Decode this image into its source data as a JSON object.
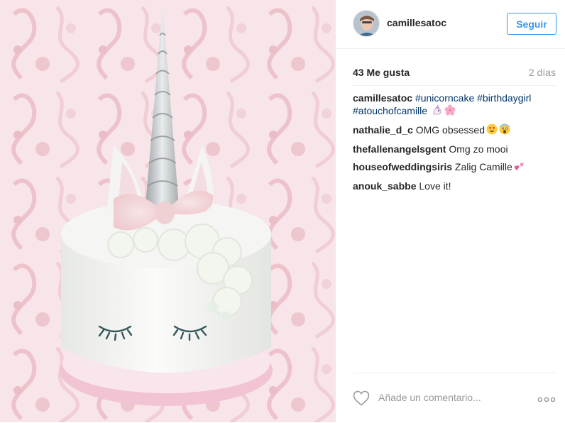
{
  "post": {
    "username": "camillesatoc",
    "follow_label": "Seguir",
    "likes": "43 Me gusta",
    "time": "2 días",
    "caption": {
      "user": "camillesatoc",
      "hashtags": [
        "#unicorncake",
        "#birthdaygirl",
        "#atouchofcamille"
      ],
      "emojis": [
        "unicorn-emoji",
        "cherry-blossom-emoji"
      ]
    },
    "comments": [
      {
        "user": "nathalie_d_c",
        "text": "OMG obsessed",
        "emojis": [
          "heart-eyes-emoji",
          "scream-emoji"
        ]
      },
      {
        "user": "thefallenangelsgent",
        "text": "Omg zo mooi",
        "emojis": []
      },
      {
        "user": "houseofweddingsiris",
        "text": "Zalig Camille",
        "emojis": [
          "two-hearts-emoji"
        ]
      },
      {
        "user": "anouk_sabbe",
        "text": "Love it!",
        "emojis": []
      }
    ],
    "comment_placeholder": "Añade un comentario...",
    "icons": [
      "heart-icon",
      "more-options-icon"
    ],
    "colors": {
      "accent": "#3897f0",
      "hashtag": "#003569",
      "muted": "#999999"
    }
  }
}
